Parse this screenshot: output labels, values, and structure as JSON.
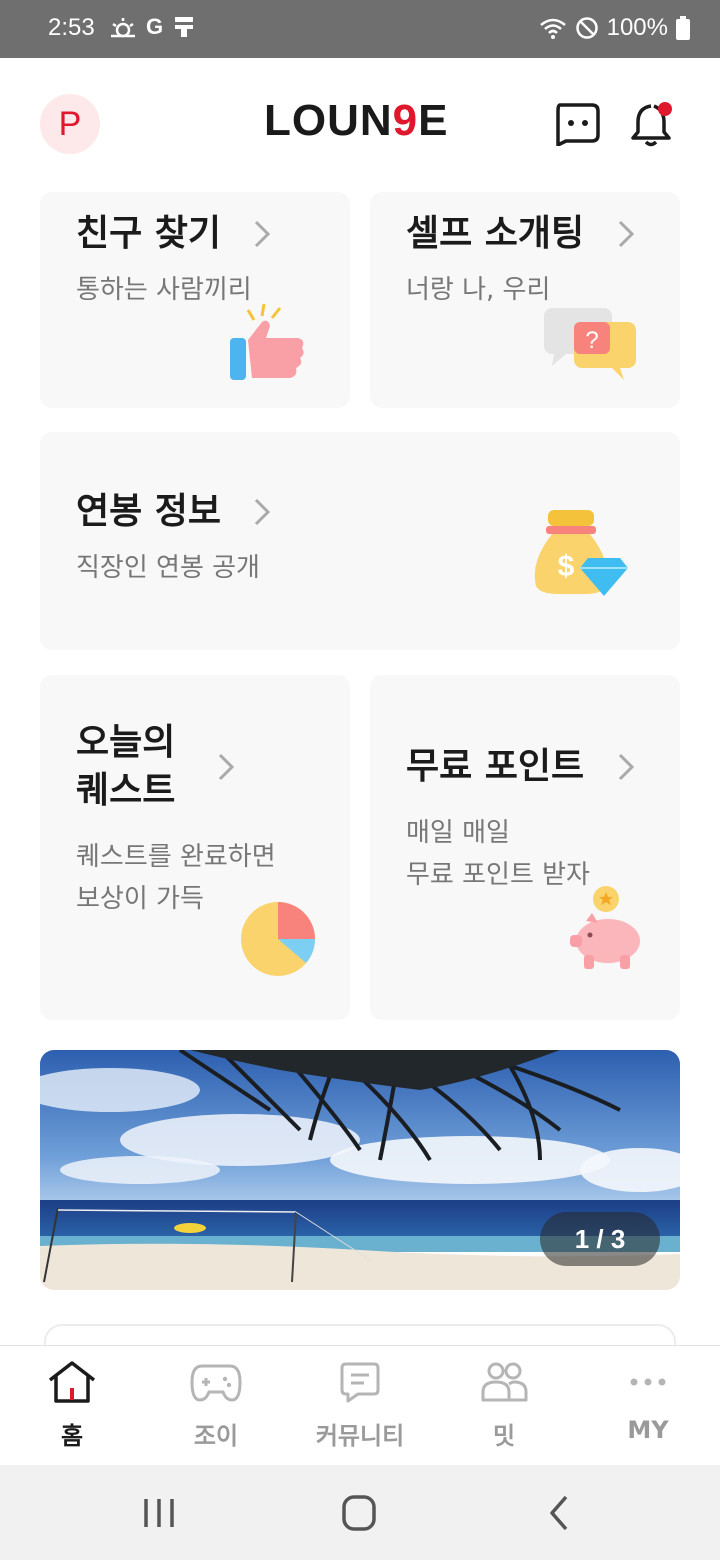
{
  "status_bar": {
    "time": "2:53",
    "left_icons": [
      "weather-icon",
      "google-icon",
      "notification-icon"
    ],
    "g_letter": "G",
    "battery": "100%"
  },
  "header": {
    "avatar_letter": "P",
    "logo_prefix": "LOUN",
    "logo_nine": "9",
    "logo_suffix": "E",
    "accent_color": "#e0182d"
  },
  "cards": {
    "friends": {
      "title": "친구 찾기",
      "subtitle": "통하는 사람끼리"
    },
    "blind_date": {
      "title": "셀프 소개팅",
      "subtitle": "너랑 나, 우리"
    },
    "salary": {
      "title": "연봉 정보",
      "subtitle": "직장인 연봉 공개"
    },
    "quest": {
      "title_line1": "오늘의",
      "title_line2": "퀘스트",
      "sub_line1": "퀘스트를 완료하면",
      "sub_line2": "보상이 가득"
    },
    "points": {
      "title": "무료 포인트",
      "sub_line1": "매일 매일",
      "sub_line2": "무료 포인트 받자"
    }
  },
  "banner": {
    "counter": "1 / 3"
  },
  "bottom_nav": {
    "items": [
      {
        "label": "홈",
        "icon": "home-icon",
        "active": true
      },
      {
        "label": "조이",
        "icon": "gamepad-icon",
        "active": false
      },
      {
        "label": "커뮤니티",
        "icon": "chat-bubble-icon",
        "active": false
      },
      {
        "label": "밋",
        "icon": "people-icon",
        "active": false
      },
      {
        "label": "MY",
        "icon": "more-dots-icon",
        "active": false
      }
    ]
  }
}
